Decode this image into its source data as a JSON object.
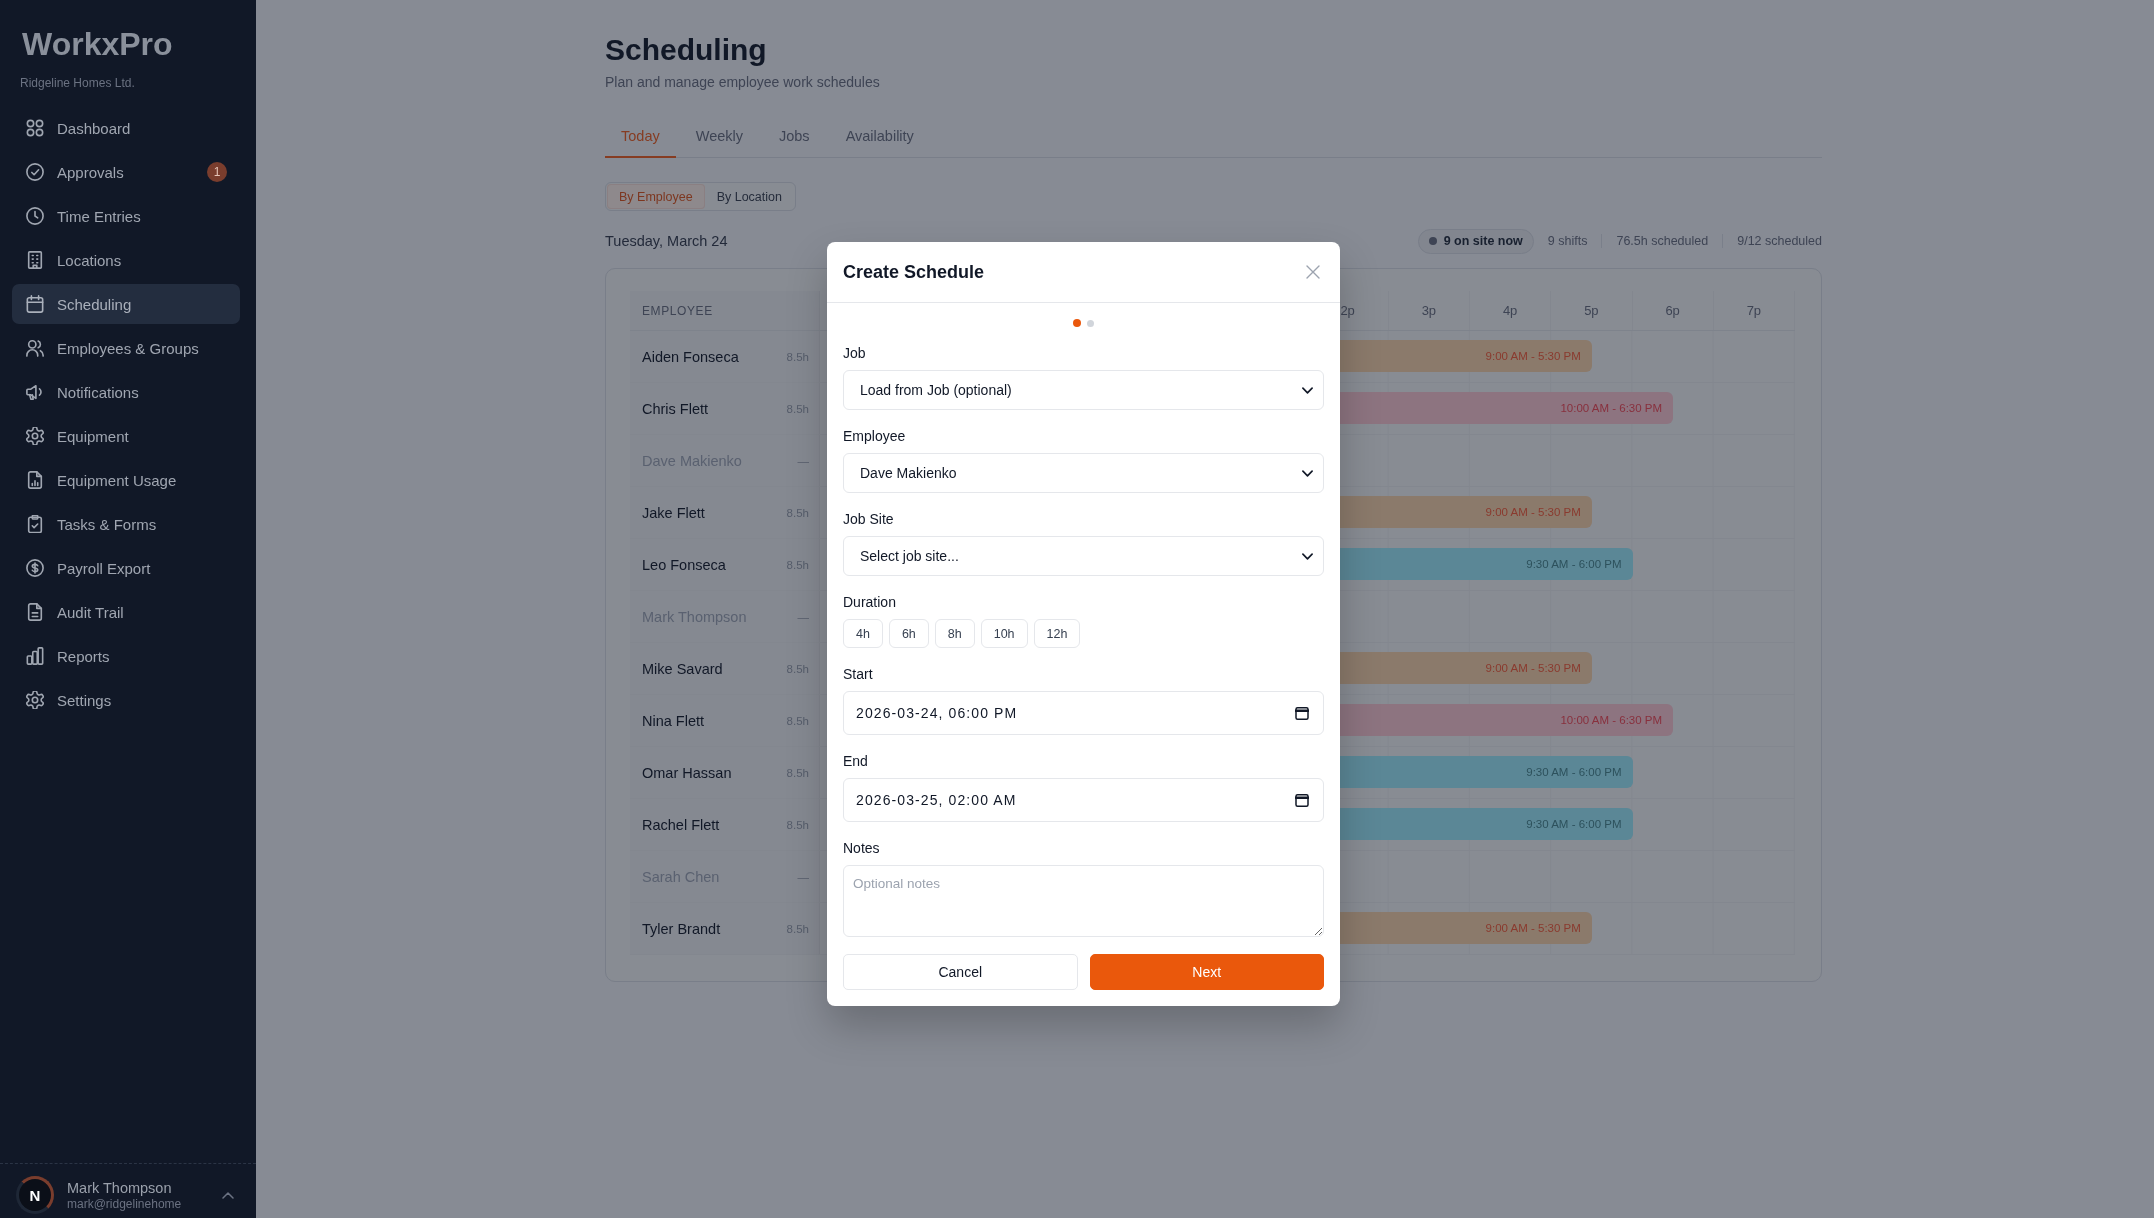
{
  "sidebar": {
    "logo": "WorkxPro",
    "organization": "Ridgeline Homes Ltd.",
    "items": [
      {
        "label": "Dashboard",
        "selected": false
      },
      {
        "label": "Approvals",
        "selected": false,
        "badge": "1"
      },
      {
        "label": "Time Entries",
        "selected": false
      },
      {
        "label": "Locations",
        "selected": false
      },
      {
        "label": "Scheduling",
        "selected": true
      },
      {
        "label": "Employees & Groups",
        "selected": false
      },
      {
        "label": "Notifications",
        "selected": false
      },
      {
        "label": "Equipment",
        "selected": false
      },
      {
        "label": "Equipment Usage",
        "selected": false
      },
      {
        "label": "Tasks & Forms",
        "selected": false
      },
      {
        "label": "Payroll Export",
        "selected": false
      },
      {
        "label": "Audit Trail",
        "selected": false
      },
      {
        "label": "Reports",
        "selected": false
      },
      {
        "label": "Settings",
        "selected": false
      }
    ],
    "user": {
      "avatar": "N",
      "name": "Mark Thompson",
      "email": "mark@ridgelinehome"
    }
  },
  "page": {
    "title": "Scheduling",
    "subtitle": "Plan and manage employee work schedules"
  },
  "tabs": [
    {
      "label": "Today",
      "selected": true
    },
    {
      "label": "Weekly",
      "selected": false
    },
    {
      "label": "Jobs",
      "selected": false
    },
    {
      "label": "Availability",
      "selected": false
    }
  ],
  "view_toggle": [
    {
      "label": "By Employee",
      "selected": true
    },
    {
      "label": "By Location",
      "selected": false
    }
  ],
  "date": "Tuesday, March 24",
  "on_site_badge": "9 on site now",
  "stats": [
    "9 shifts",
    "76.5h scheduled",
    "9/12 scheduled"
  ],
  "table": {
    "employee_header": "EMPLOYEE",
    "hour_headers": [
      "2p",
      "3p",
      "4p",
      "5p",
      "6p",
      "7p"
    ],
    "rows": [
      {
        "name": "Aiden Fonseca",
        "hours": "8.5h",
        "scheduled": true,
        "shift": {
          "time": "9:00 AM - 5:30 PM",
          "color": "#8b7a6b"
        }
      },
      {
        "name": "Chris Flett",
        "hours": "8.5h",
        "scheduled": true,
        "shift": {
          "time": "10:00 AM - 6:30 PM",
          "color": "#8d7480"
        }
      },
      {
        "name": "Dave Makienko",
        "hours": "—",
        "scheduled": false
      },
      {
        "name": "Jake Flett",
        "hours": "8.5h",
        "scheduled": true,
        "shift": {
          "time": "9:00 AM - 5:30 PM",
          "color": "#8b7a6b"
        }
      },
      {
        "name": "Leo Fonseca",
        "hours": "8.5h",
        "scheduled": true,
        "shift": {
          "time": "9:30 AM - 6:00 PM",
          "color": "#5b8796"
        }
      },
      {
        "name": "Mark Thompson",
        "hours": "—",
        "scheduled": false
      },
      {
        "name": "Mike Savard",
        "hours": "8.5h",
        "scheduled": true,
        "shift": {
          "time": "9:00 AM - 5:30 PM",
          "color": "#8b7a6b"
        }
      },
      {
        "name": "Nina Flett",
        "hours": "8.5h",
        "scheduled": true,
        "shift": {
          "time": "10:00 AM - 6:30 PM",
          "color": "#8d7480"
        }
      },
      {
        "name": "Omar Hassan",
        "hours": "8.5h",
        "scheduled": true,
        "shift": {
          "time": "9:30 AM - 6:00 PM",
          "color": "#5b8796"
        }
      },
      {
        "name": "Rachel Flett",
        "hours": "8.5h",
        "scheduled": true,
        "shift": {
          "time": "9:30 AM - 6:00 PM",
          "color": "#5b8796"
        }
      },
      {
        "name": "Sarah Chen",
        "hours": "—",
        "scheduled": false
      },
      {
        "name": "Tyler Brandt",
        "hours": "8.5h",
        "scheduled": true,
        "shift": {
          "time": "9:00 AM - 5:30 PM",
          "color": "#8b7a6b"
        }
      }
    ]
  },
  "modal": {
    "title": "Create Schedule",
    "steps": [
      {
        "selected": true
      },
      {
        "selected": false
      }
    ],
    "fields": [
      {
        "kind": "select",
        "label": "Job",
        "value": "Load from Job (optional)"
      },
      {
        "kind": "select",
        "label": "Employee",
        "value": "Dave Makienko"
      },
      {
        "kind": "select",
        "label": "Job Site",
        "value": "Select job site..."
      },
      {
        "kind": "chips",
        "label": "Duration",
        "options": [
          {
            "label": "4h",
            "selected": false
          },
          {
            "label": "6h",
            "selected": false
          },
          {
            "label": "8h",
            "selected": false
          },
          {
            "label": "10h",
            "selected": false
          },
          {
            "label": "12h",
            "selected": false
          }
        ]
      },
      {
        "kind": "datetime",
        "label": "Start",
        "value": "2026-03-24, 06:00 PM"
      },
      {
        "kind": "datetime",
        "label": "End",
        "value": "2026-03-25, 02:00 AM"
      },
      {
        "kind": "textarea",
        "label": "Notes",
        "placeholder": "Optional notes"
      }
    ],
    "buttons": [
      {
        "kind": "secondary",
        "label": "Cancel"
      },
      {
        "kind": "primary",
        "label": "Next"
      }
    ]
  }
}
